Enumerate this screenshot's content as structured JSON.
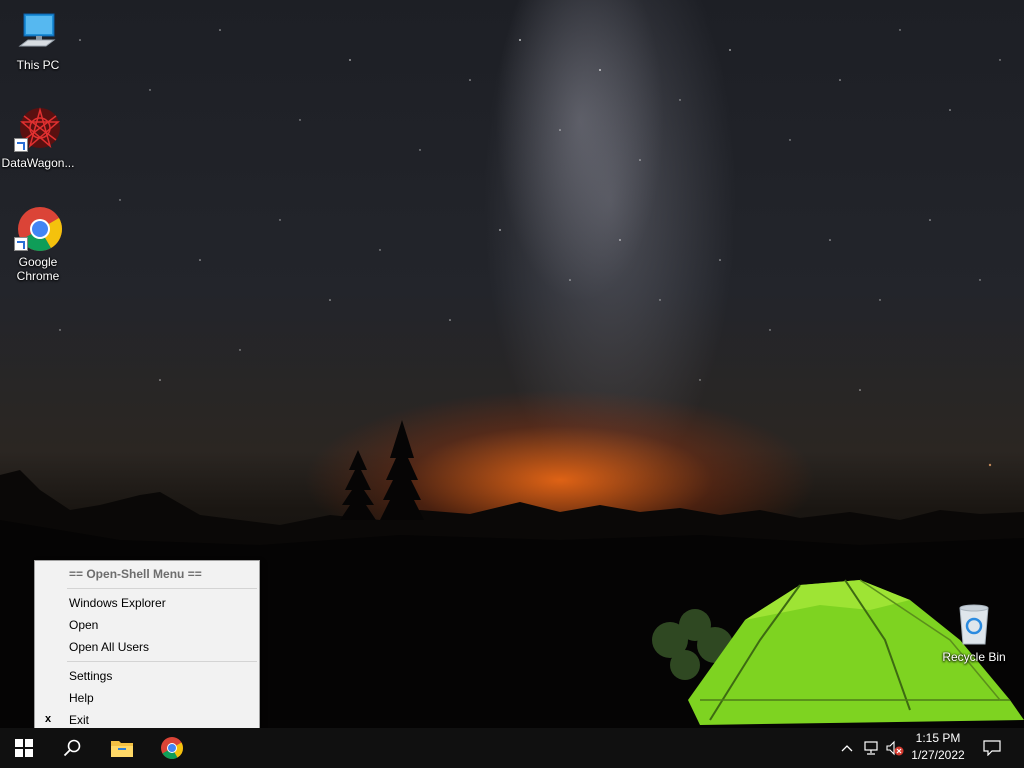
{
  "desktop": {
    "icons": [
      {
        "label": "This PC"
      },
      {
        "label": "DataWagon..."
      },
      {
        "label": "Google Chrome"
      },
      {
        "label": "Recycle Bin"
      }
    ]
  },
  "context_menu": {
    "header": "== Open-Shell Menu ==",
    "items": [
      "Windows Explorer",
      "Open",
      "Open All Users",
      "Settings",
      "Help",
      "Exit"
    ],
    "exit_mark": "x"
  },
  "taskbar": {
    "time": "1:15 PM",
    "date": "1/27/2022",
    "pinned": [
      "start-button",
      "search-button",
      "file-explorer",
      "google-chrome"
    ],
    "tray": [
      "chevron-up-icon",
      "network-icon",
      "volume-muted-icon",
      "action-center-icon"
    ],
    "colors": {
      "background": "#101010",
      "chrome_red": "#db4437",
      "chrome_yellow": "#f4c20d",
      "chrome_green": "#0f9d58",
      "chrome_blue": "#4285f4"
    }
  }
}
